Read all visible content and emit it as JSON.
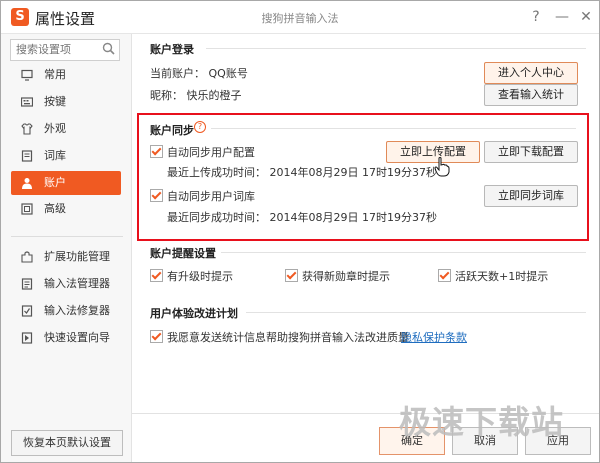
{
  "titlebar": {
    "logo_letter": "S",
    "app_title": "属性设置",
    "caption": "搜狗拼音输入法",
    "help_glyph": "?",
    "minimize_glyph": "—",
    "close_glyph": "✕"
  },
  "sidebar": {
    "search_placeholder": "搜索设置项",
    "items": [
      {
        "label": "常用",
        "icon": "monitor-icon"
      },
      {
        "label": "按键",
        "icon": "keyboard-icon"
      },
      {
        "label": "外观",
        "icon": "shirt-icon"
      },
      {
        "label": "词库",
        "icon": "book-icon"
      },
      {
        "label": "账户",
        "icon": "user-icon",
        "active": true
      },
      {
        "label": "高级",
        "icon": "advanced-icon"
      }
    ],
    "tools": [
      {
        "label": "扩展功能管理",
        "icon": "extension-icon"
      },
      {
        "label": "输入法管理器",
        "icon": "manager-icon"
      },
      {
        "label": "输入法修复器",
        "icon": "repair-icon"
      },
      {
        "label": "快速设置向导",
        "icon": "wizard-icon"
      }
    ],
    "restore_label": "恢复本页默认设置"
  },
  "account_login": {
    "title": "账户登录",
    "current_account": "当前账户： QQ账号",
    "nickname": "昵称：  快乐的橙子",
    "personal_center_btn": "进入个人中心",
    "view_stats_btn": "查看输入统计"
  },
  "account_sync": {
    "title": "账户同步",
    "sync_config_label": "自动同步用户配置",
    "config_last_upload": "最近上传成功时间：  2014年08月29日  17时19分37秒",
    "upload_now_btn": "立即上传配置",
    "download_now_btn": "立即下载配置",
    "sync_dict_label": "自动同步用户词库",
    "dict_last_sync": "最近同步成功时间：  2014年08月29日  17时19分37秒",
    "sync_dict_btn": "立即同步词库"
  },
  "account_reminder": {
    "title": "账户提醒设置",
    "upgrade_label": "有升级时提示",
    "badge_label": "获得新勋章时提示",
    "active_days_label": "活跃天数+1时提示"
  },
  "ux_plan": {
    "title": "用户体验改进计划",
    "agree_label": "我愿意发送统计信息帮助搜狗拼音输入法改进质量",
    "privacy_link": "隐私保护条款"
  },
  "footer": {
    "ok_label": "确定",
    "cancel_label": "取消",
    "apply_label": "应用"
  },
  "watermark": "极速下载站",
  "colors": {
    "accent": "#f05a22",
    "highlight_border": "#e8101c",
    "link": "#1f6dbf"
  }
}
